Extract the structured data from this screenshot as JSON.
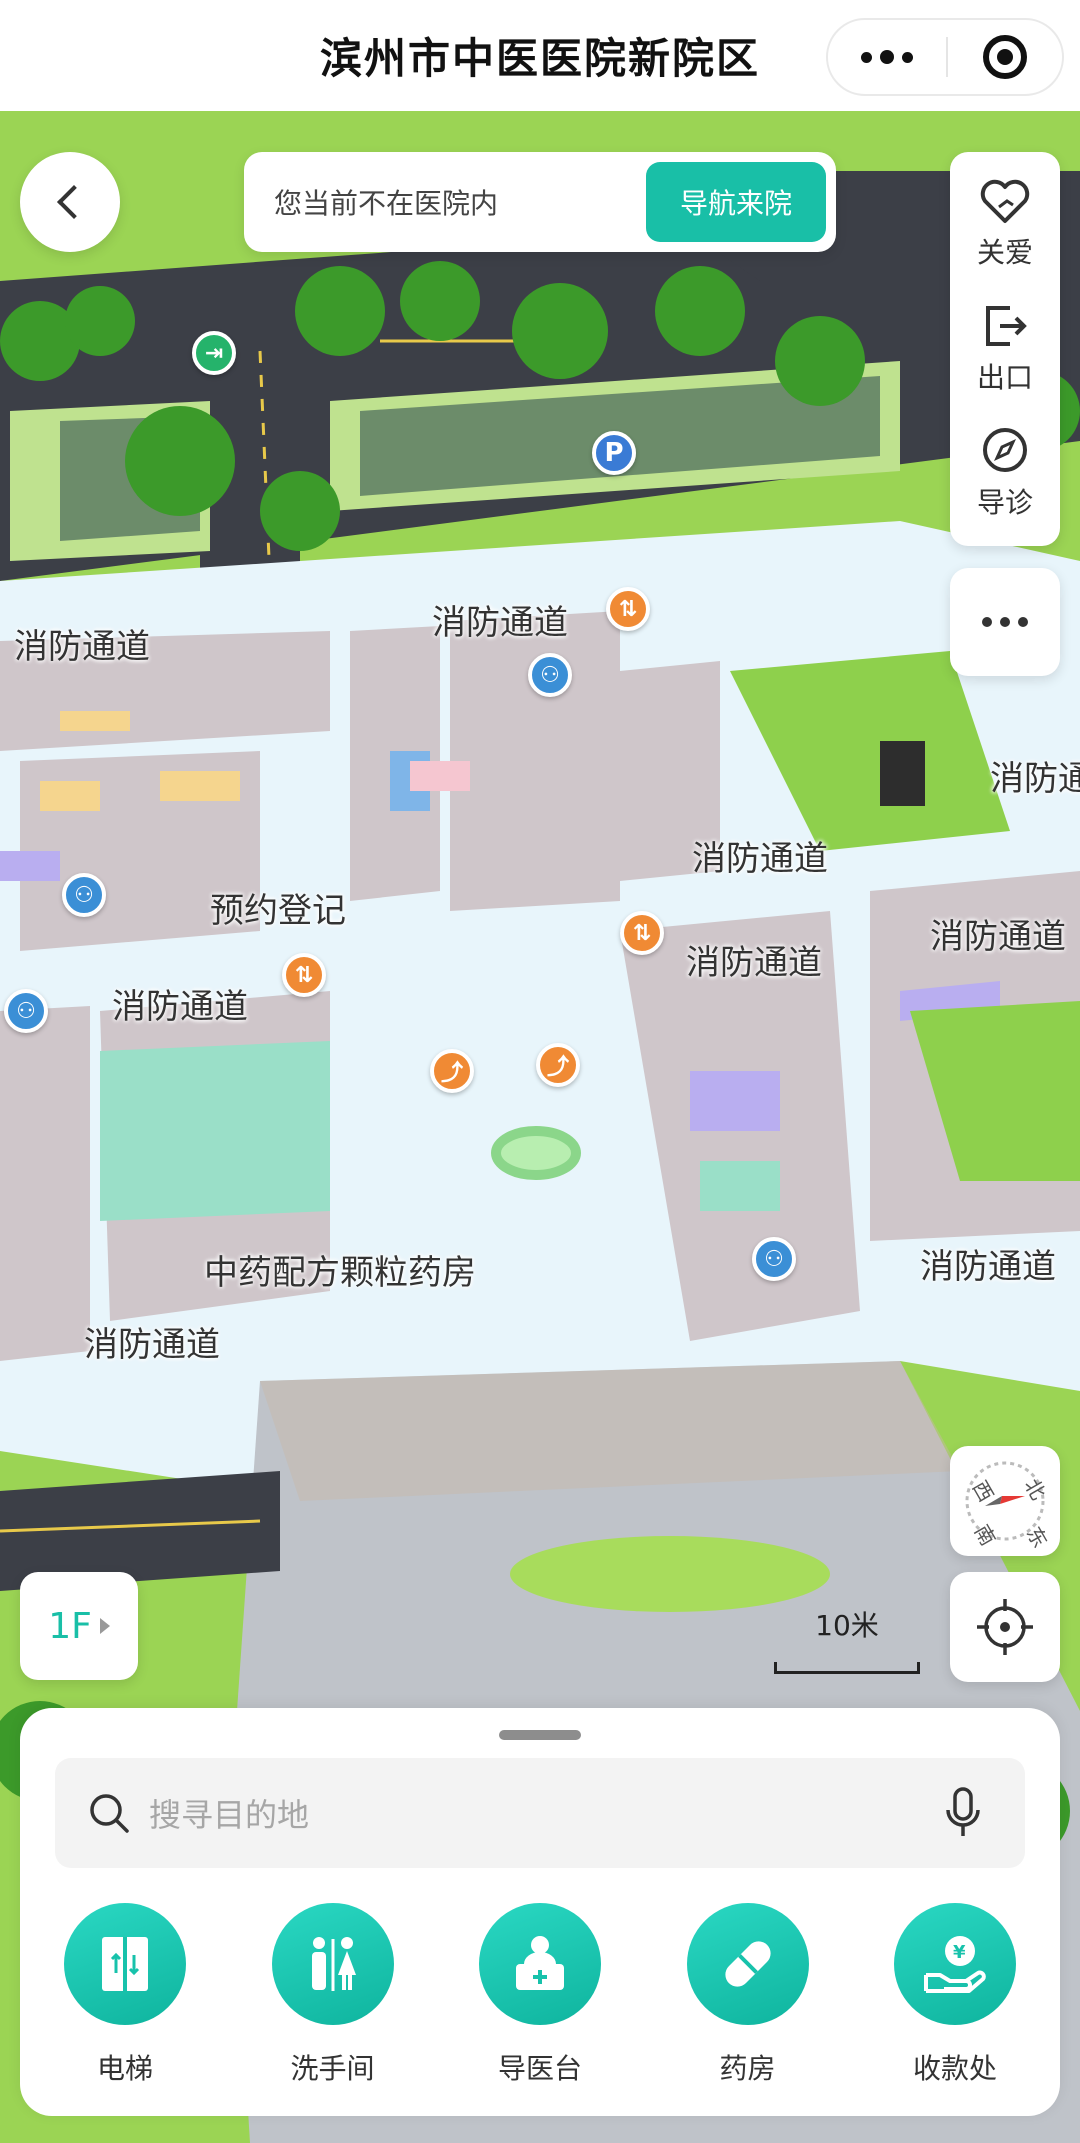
{
  "header": {
    "title": "滨州市中医医院新院区"
  },
  "notice": {
    "message": "您当前不在医院内",
    "nav_button": "导航来院"
  },
  "side_panel": {
    "items": [
      {
        "label": "关爱",
        "icon": "heart-care-icon"
      },
      {
        "label": "出口",
        "icon": "exit-icon"
      },
      {
        "label": "导诊",
        "icon": "compass-guide-icon"
      }
    ]
  },
  "map": {
    "labels": {
      "fire_1": "消防通道",
      "fire_2": "消防通道",
      "fire_3": "消防通道",
      "fire_4": "消防通道",
      "fire_5": "消防通道",
      "fire_6": "消防通道",
      "fire_7": "消防通道",
      "fire_8": "消防通道",
      "fire_9": "消防通道",
      "reservation": "预约登记",
      "pharmacy_granule": "中药配方颗粒药房"
    },
    "compass": {
      "north": "北",
      "south": "南",
      "east": "东",
      "west": "西"
    },
    "scale": "10米",
    "floor": "1F"
  },
  "search": {
    "placeholder": "搜寻目的地"
  },
  "quick_actions": [
    {
      "label": "电梯",
      "icon": "elevator-icon"
    },
    {
      "label": "洗手间",
      "icon": "restroom-icon"
    },
    {
      "label": "导医台",
      "icon": "guide-desk-icon"
    },
    {
      "label": "药房",
      "icon": "pill-icon"
    },
    {
      "label": "收款处",
      "icon": "cashier-icon"
    }
  ],
  "colors": {
    "accent": "#19bfa7",
    "grass": "#9bd454",
    "road": "#3c3f47",
    "floor": "#e8f5fb",
    "walls": "#c9bfc4"
  }
}
